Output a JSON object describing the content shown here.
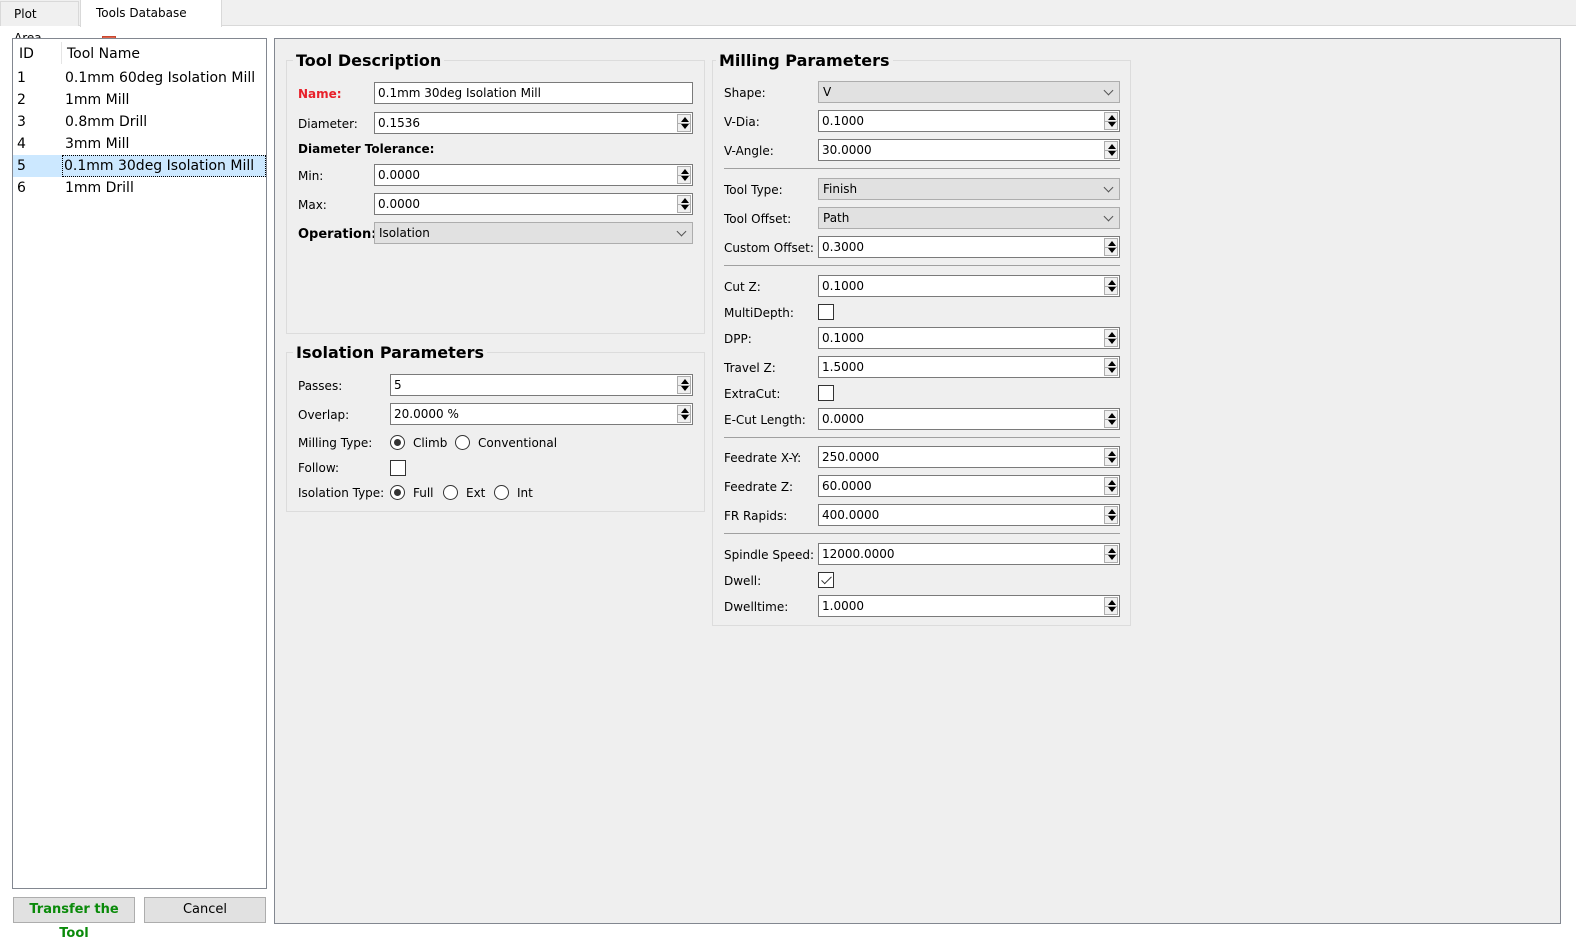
{
  "tabs": [
    {
      "label": "Plot Area",
      "active": false
    },
    {
      "label": "Tools Database",
      "active": true,
      "closable": true
    }
  ],
  "tool_list": {
    "columns": [
      "ID",
      "Tool Name"
    ],
    "rows": [
      {
        "id": "1",
        "name": "0.1mm 60deg Isolation Mill"
      },
      {
        "id": "2",
        "name": "1mm Mill"
      },
      {
        "id": "3",
        "name": "0.8mm Drill"
      },
      {
        "id": "4",
        "name": "3mm Mill"
      },
      {
        "id": "5",
        "name": "0.1mm 30deg Isolation Mill",
        "selected": true
      },
      {
        "id": "6",
        "name": "1mm Drill"
      }
    ]
  },
  "buttons": {
    "transfer": "Transfer the Tool",
    "cancel": "Cancel"
  },
  "tool_description": {
    "title": "Tool Description",
    "name_label": "Name:",
    "name_value": "0.1mm 30deg Isolation Mill",
    "diameter_label": "Diameter:",
    "diameter_value": "0.1536",
    "tolerance_label": "Diameter Tolerance:",
    "min_label": "Min:",
    "min_value": "0.0000",
    "max_label": "Max:",
    "max_value": "0.0000",
    "operation_label": "Operation:",
    "operation_value": "Isolation"
  },
  "isolation_parameters": {
    "title": "Isolation Parameters",
    "passes_label": "Passes:",
    "passes_value": "5",
    "overlap_label": "Overlap:",
    "overlap_value": "20.0000 %",
    "milling_type_label": "Milling Type:",
    "milling_type_options": [
      "Climb",
      "Conventional"
    ],
    "milling_type_selected": "Climb",
    "follow_label": "Follow:",
    "follow_checked": false,
    "isolation_type_label": "Isolation Type:",
    "isolation_type_options": [
      "Full",
      "Ext",
      "Int"
    ],
    "isolation_type_selected": "Full"
  },
  "milling_parameters": {
    "title": "Milling Parameters",
    "shape_label": "Shape:",
    "shape_value": "V",
    "vdia_label": "V-Dia:",
    "vdia_value": "0.1000",
    "vangle_label": "V-Angle:",
    "vangle_value": "30.0000",
    "tooltype_label": "Tool Type:",
    "tooltype_value": "Finish",
    "tooloffset_label": "Tool Offset:",
    "tooloffset_value": "Path",
    "customoffset_label": "Custom Offset:",
    "customoffset_value": "0.3000",
    "cutz_label": "Cut Z:",
    "cutz_value": "0.1000",
    "multidepth_label": "MultiDepth:",
    "multidepth_checked": false,
    "dpp_label": "DPP:",
    "dpp_value": "0.1000",
    "travelz_label": "Travel Z:",
    "travelz_value": "1.5000",
    "extracut_label": "ExtraCut:",
    "extracut_checked": false,
    "ecutlength_label": "E-Cut Length:",
    "ecutlength_value": "0.0000",
    "feedxy_label": "Feedrate X-Y:",
    "feedxy_value": "250.0000",
    "feedz_label": "Feedrate Z:",
    "feedz_value": "60.0000",
    "frrapids_label": "FR Rapids:",
    "frrapids_value": "400.0000",
    "spindle_label": "Spindle Speed:",
    "spindle_value": "12000.0000",
    "dwell_label": "Dwell:",
    "dwell_checked": true,
    "dwelltime_label": "Dwelltime:",
    "dwelltime_value": "1.0000"
  }
}
